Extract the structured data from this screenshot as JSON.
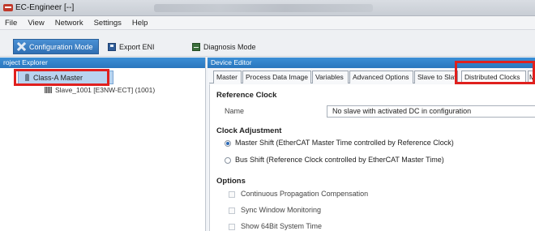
{
  "window": {
    "title": "EC-Engineer [--]"
  },
  "menu": [
    "File",
    "View",
    "Network",
    "Settings",
    "Help"
  ],
  "toolbar": {
    "config_mode": "Configuration Mode",
    "export_eni": "Export ENI",
    "diagnosis_mode": "Diagnosis Mode"
  },
  "explorer": {
    "header": "roject Explorer",
    "master": "Class-A Master",
    "slave": "Slave_1001 [E3NW-ECT] (1001)"
  },
  "editor": {
    "header": "Device Editor",
    "tabs": [
      "Master",
      "Process Data Image",
      "Variables",
      "Advanced Options",
      "Slave to Slav",
      "Distributed Clocks",
      "M"
    ],
    "active_tab": "Distributed Clocks"
  },
  "reference_clock": {
    "title": "Reference Clock",
    "name_label": "Name",
    "name_value": "No slave with activated DC in configuration"
  },
  "clock_adjustment": {
    "title": "Clock Adjustment",
    "master_shift": "Master Shift (EtherCAT Master Time controlled by Reference Clock)",
    "bus_shift": "Bus Shift (Reference Clock controlled by EtherCAT Master Time)",
    "selected": "master_shift"
  },
  "options": {
    "title": "Options",
    "continuous": "Continuous Propagation Compensation",
    "sync_window": "Sync Window Monitoring",
    "show_64bit": "Show 64Bit System Time"
  },
  "colors": {
    "highlight": "#e0201e",
    "accent": "#2f6fb3"
  }
}
